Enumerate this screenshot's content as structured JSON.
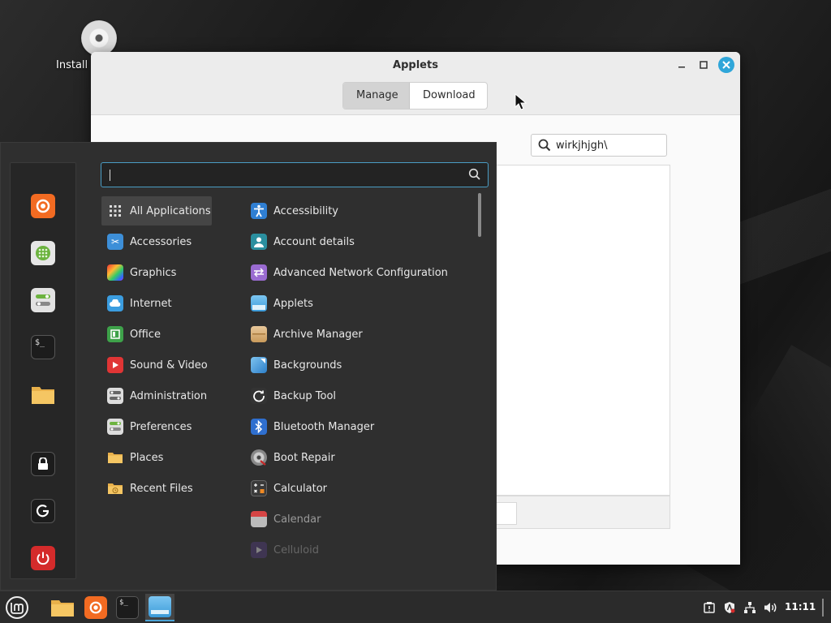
{
  "desktop": {
    "icon_label": "Install"
  },
  "window": {
    "title": "Applets",
    "tabs": [
      {
        "label": "Manage"
      },
      {
        "label": "Download"
      }
    ],
    "search_value": "wirkjhjgh\\"
  },
  "menu": {
    "search_value": "",
    "categories": [
      {
        "label": "All Applications",
        "icon": "grid-icon"
      },
      {
        "label": "Accessories",
        "icon": "scissors-icon"
      },
      {
        "label": "Graphics",
        "icon": "graphics-icon"
      },
      {
        "label": "Internet",
        "icon": "cloud-icon"
      },
      {
        "label": "Office",
        "icon": "office-icon"
      },
      {
        "label": "Sound & Video",
        "icon": "play-icon"
      },
      {
        "label": "Administration",
        "icon": "admin-icon"
      },
      {
        "label": "Preferences",
        "icon": "preferences-icon"
      },
      {
        "label": "Places",
        "icon": "folder-icon"
      },
      {
        "label": "Recent Files",
        "icon": "recent-folder-icon"
      }
    ],
    "apps": [
      {
        "label": "Accessibility",
        "icon": "accessibility-icon"
      },
      {
        "label": "Account details",
        "icon": "account-icon"
      },
      {
        "label": "Advanced Network Configuration",
        "icon": "network-config-icon"
      },
      {
        "label": "Applets",
        "icon": "applets-icon"
      },
      {
        "label": "Archive Manager",
        "icon": "archive-icon"
      },
      {
        "label": "Backgrounds",
        "icon": "backgrounds-icon"
      },
      {
        "label": "Backup Tool",
        "icon": "backup-icon"
      },
      {
        "label": "Bluetooth Manager",
        "icon": "bluetooth-icon"
      },
      {
        "label": "Boot Repair",
        "icon": "boot-repair-icon"
      },
      {
        "label": "Calculator",
        "icon": "calculator-icon"
      },
      {
        "label": "Calendar",
        "icon": "calendar-icon"
      },
      {
        "label": "Celluloid",
        "icon": "celluloid-icon"
      }
    ],
    "favorites": [
      "firefox-icon",
      "software-manager-icon",
      "settings-icon",
      "terminal-icon",
      "files-icon"
    ],
    "session": [
      "lock-icon",
      "logout-icon",
      "power-icon"
    ]
  },
  "taskbar": {
    "clock": "11:11"
  },
  "colors": {
    "accent": "#2fa6d9",
    "menu_bg": "#2f2f2f",
    "firefox": "#f26b22",
    "power": "#d42b2b"
  }
}
